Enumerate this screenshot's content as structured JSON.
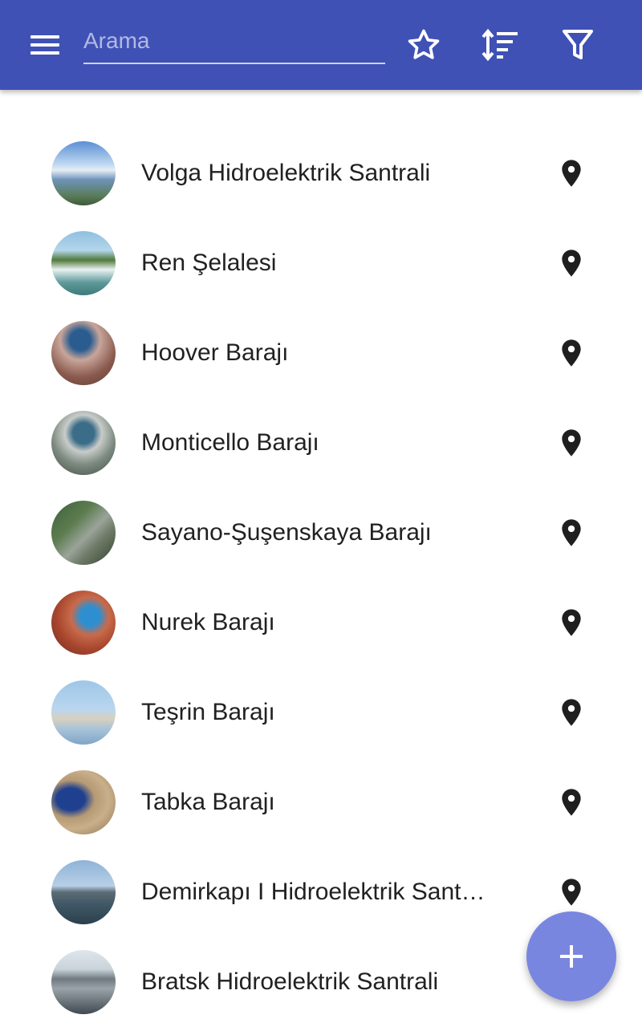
{
  "appbar": {
    "search_placeholder": "Arama",
    "menu_icon": "menu-icon",
    "favorite_icon": "star-outline-icon",
    "sort_icon": "sort-icon",
    "filter_icon": "filter-icon",
    "color": "#3F51B5"
  },
  "list": {
    "items": [
      {
        "name": "Volga Hidroelektrik Santrali"
      },
      {
        "name": "Ren Şelalesi"
      },
      {
        "name": "Hoover Barajı"
      },
      {
        "name": "Monticello Barajı"
      },
      {
        "name": "Sayano-Şuşenskaya Barajı"
      },
      {
        "name": "Nurek Barajı"
      },
      {
        "name": "Teşrin Barajı"
      },
      {
        "name": "Tabka Barajı"
      },
      {
        "name": "Demirkapı I Hidroelektrik Sant…"
      },
      {
        "name": "Bratsk Hidroelektrik Santrali"
      }
    ]
  },
  "fab": {
    "icon": "plus-icon",
    "color": "#7986E0"
  }
}
